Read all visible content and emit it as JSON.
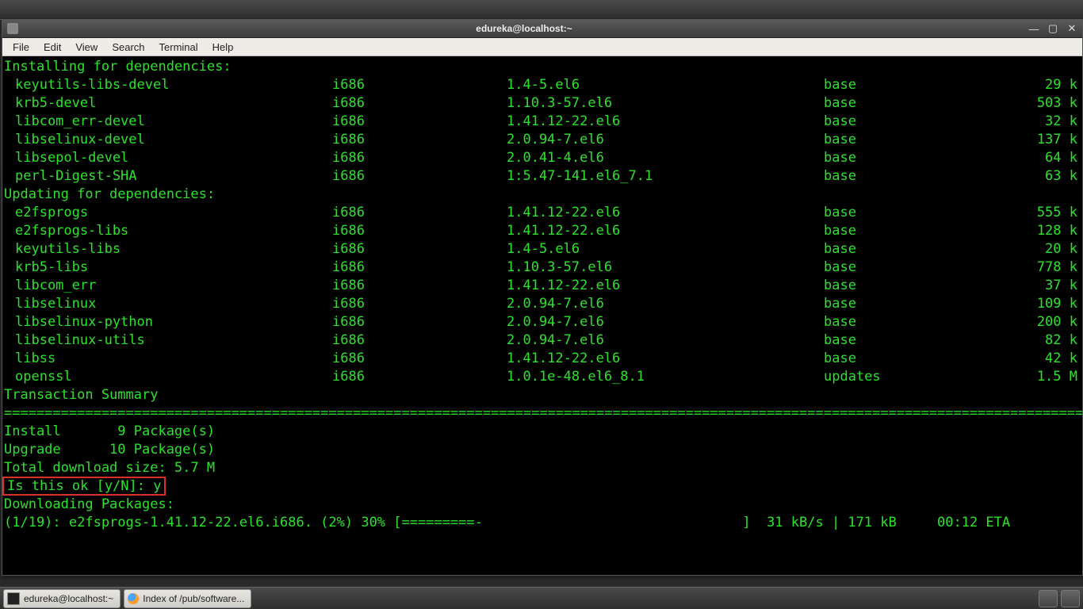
{
  "window": {
    "title": "edureka@localhost:~",
    "menus": [
      "File",
      "Edit",
      "View",
      "Search",
      "Terminal",
      "Help"
    ]
  },
  "sections": {
    "install_header": "Installing for dependencies:",
    "update_header": "Updating for dependencies:",
    "summary_header": "Transaction Summary"
  },
  "install_deps": [
    {
      "name": "keyutils-libs-devel",
      "arch": "i686",
      "ver": "1.4-5.el6",
      "repo": "base",
      "size": "29 k"
    },
    {
      "name": "krb5-devel",
      "arch": "i686",
      "ver": "1.10.3-57.el6",
      "repo": "base",
      "size": "503 k"
    },
    {
      "name": "libcom_err-devel",
      "arch": "i686",
      "ver": "1.41.12-22.el6",
      "repo": "base",
      "size": "32 k"
    },
    {
      "name": "libselinux-devel",
      "arch": "i686",
      "ver": "2.0.94-7.el6",
      "repo": "base",
      "size": "137 k"
    },
    {
      "name": "libsepol-devel",
      "arch": "i686",
      "ver": "2.0.41-4.el6",
      "repo": "base",
      "size": "64 k"
    },
    {
      "name": "perl-Digest-SHA",
      "arch": "i686",
      "ver": "1:5.47-141.el6_7.1",
      "repo": "base",
      "size": "63 k"
    }
  ],
  "update_deps": [
    {
      "name": "e2fsprogs",
      "arch": "i686",
      "ver": "1.41.12-22.el6",
      "repo": "base",
      "size": "555 k"
    },
    {
      "name": "e2fsprogs-libs",
      "arch": "i686",
      "ver": "1.41.12-22.el6",
      "repo": "base",
      "size": "128 k"
    },
    {
      "name": "keyutils-libs",
      "arch": "i686",
      "ver": "1.4-5.el6",
      "repo": "base",
      "size": "20 k"
    },
    {
      "name": "krb5-libs",
      "arch": "i686",
      "ver": "1.10.3-57.el6",
      "repo": "base",
      "size": "778 k"
    },
    {
      "name": "libcom_err",
      "arch": "i686",
      "ver": "1.41.12-22.el6",
      "repo": "base",
      "size": "37 k"
    },
    {
      "name": "libselinux",
      "arch": "i686",
      "ver": "2.0.94-7.el6",
      "repo": "base",
      "size": "109 k"
    },
    {
      "name": "libselinux-python",
      "arch": "i686",
      "ver": "2.0.94-7.el6",
      "repo": "base",
      "size": "200 k"
    },
    {
      "name": "libselinux-utils",
      "arch": "i686",
      "ver": "2.0.94-7.el6",
      "repo": "base",
      "size": "82 k"
    },
    {
      "name": "libss",
      "arch": "i686",
      "ver": "1.41.12-22.el6",
      "repo": "base",
      "size": "42 k"
    },
    {
      "name": "openssl",
      "arch": "i686",
      "ver": "1.0.1e-48.el6_8.1",
      "repo": "updates",
      "size": "1.5 M"
    }
  ],
  "summary": {
    "rule": "================================================================================================================================================",
    "install_line": "Install       9 Package(s)",
    "upgrade_line": "Upgrade      10 Package(s)",
    "dl_size": "Total download size: 5.7 M",
    "confirm": "Is this ok [y/N]: y",
    "downloading": "Downloading Packages:",
    "progress": "(1/19): e2fsprogs-1.41.12-22.el6.i686. (2%) 30% [=========-                                ]  31 kB/s | 171 kB     00:12 ETA"
  },
  "taskbar": {
    "tasks": [
      {
        "label": "edureka@localhost:~"
      },
      {
        "label": "Index of /pub/software..."
      }
    ]
  }
}
